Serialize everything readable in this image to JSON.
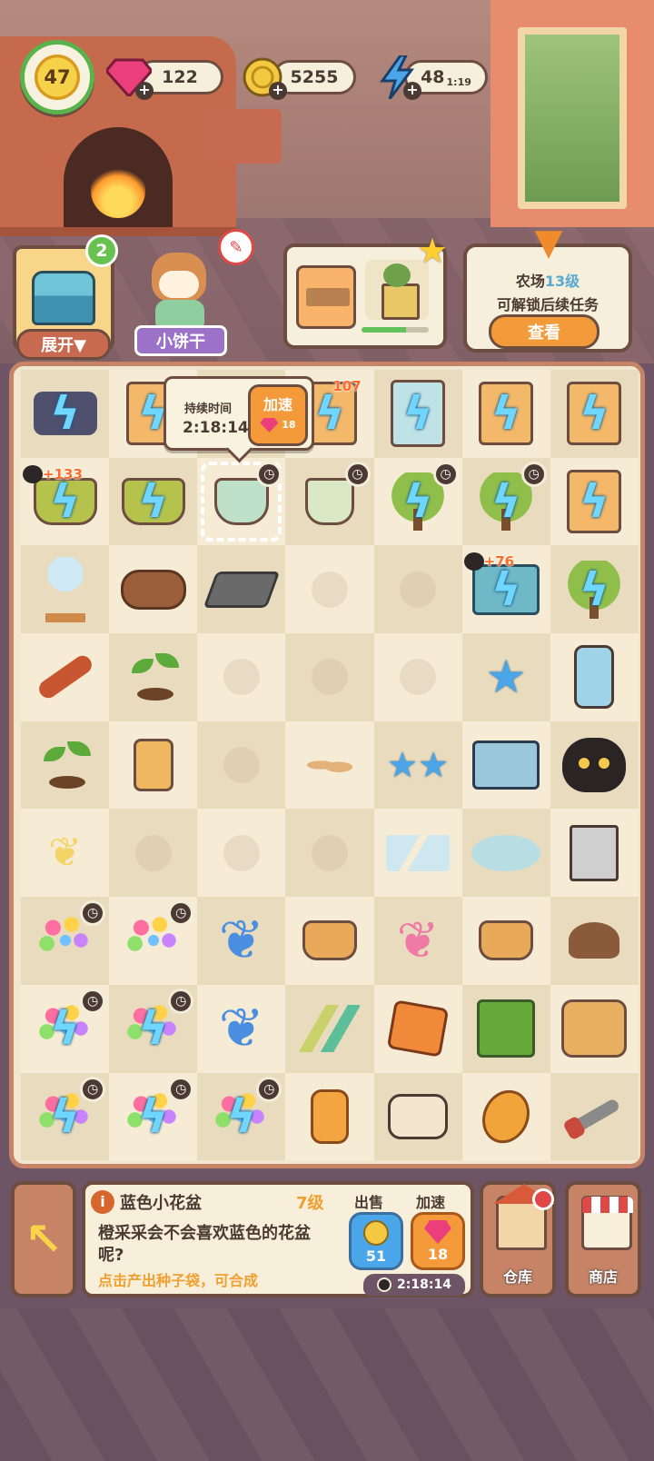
{
  "hud": {
    "level": "47",
    "gems": "122",
    "coins": "5255",
    "energy": "48",
    "energy_timer": "1:19"
  },
  "quest_row": {
    "chest_badge": "2",
    "expand_label": "展开▼",
    "npc_name": "小饼干",
    "farm_title": "农场",
    "farm_level": "13级",
    "farm_subtitle": "可解锁后续任务",
    "view_label": "查看"
  },
  "tooltip": {
    "label": "持续时间",
    "time": "2:18:14",
    "speed_label": "加速",
    "speed_cost": "18"
  },
  "board": {
    "badges": {
      "cell_0_3": "107",
      "cell_1_0": "+133",
      "cell_2_5": "+76"
    },
    "rows": [
      [
        "train-energy",
        "machine-energy",
        "tooltip-covered",
        "cabinet-energy",
        "wardrobe-energy",
        "dresser-energy",
        "drawers-energy"
      ],
      [
        "bucket-energy",
        "basket-energy",
        "blue-pot",
        "pot",
        "tree-energy",
        "tree-energy",
        "cabinet-energy"
      ],
      [
        "lamp",
        "logs",
        "iron-ingot",
        "empty",
        "empty",
        "toolbox-energy",
        "tree-energy"
      ],
      [
        "pliers",
        "sprout",
        "empty",
        "empty",
        "empty",
        "blue-star",
        "soap-bottle"
      ],
      [
        "sprout",
        "seed-bag",
        "empty",
        "seeds",
        "blue-stars",
        "crystal-tray",
        "black-cat"
      ],
      [
        "yellow-butterfly",
        "empty",
        "empty",
        "empty",
        "glass-shards",
        "glass-sand",
        "bonsai"
      ],
      [
        "flower-pot",
        "flower-pot",
        "blue-butterfly",
        "seed-pouch",
        "pink-butterfly",
        "seed-pouches",
        "soil-pile"
      ],
      [
        "flower-energy",
        "flower-energy",
        "blue-butterfly-small",
        "paint-tubes",
        "ruby",
        "hand-cart",
        "sack-pile"
      ],
      [
        "flower-energy",
        "flower-energy",
        "flower-energy",
        "amber",
        "boots",
        "amber-egg",
        "crowbar"
      ]
    ]
  },
  "info_panel": {
    "name": "蓝色小花盆",
    "level": "7级",
    "description": "橙采采会不会喜欢蓝色的花盆呢?",
    "hint": "点击产出种子袋，可合成",
    "sell_label": "出售",
    "speed_label": "加速",
    "sell_price": "51",
    "speed_cost": "18",
    "timer": "2:18:14"
  },
  "side_buttons": {
    "warehouse_label": "仓库",
    "shop_label": "商店"
  }
}
